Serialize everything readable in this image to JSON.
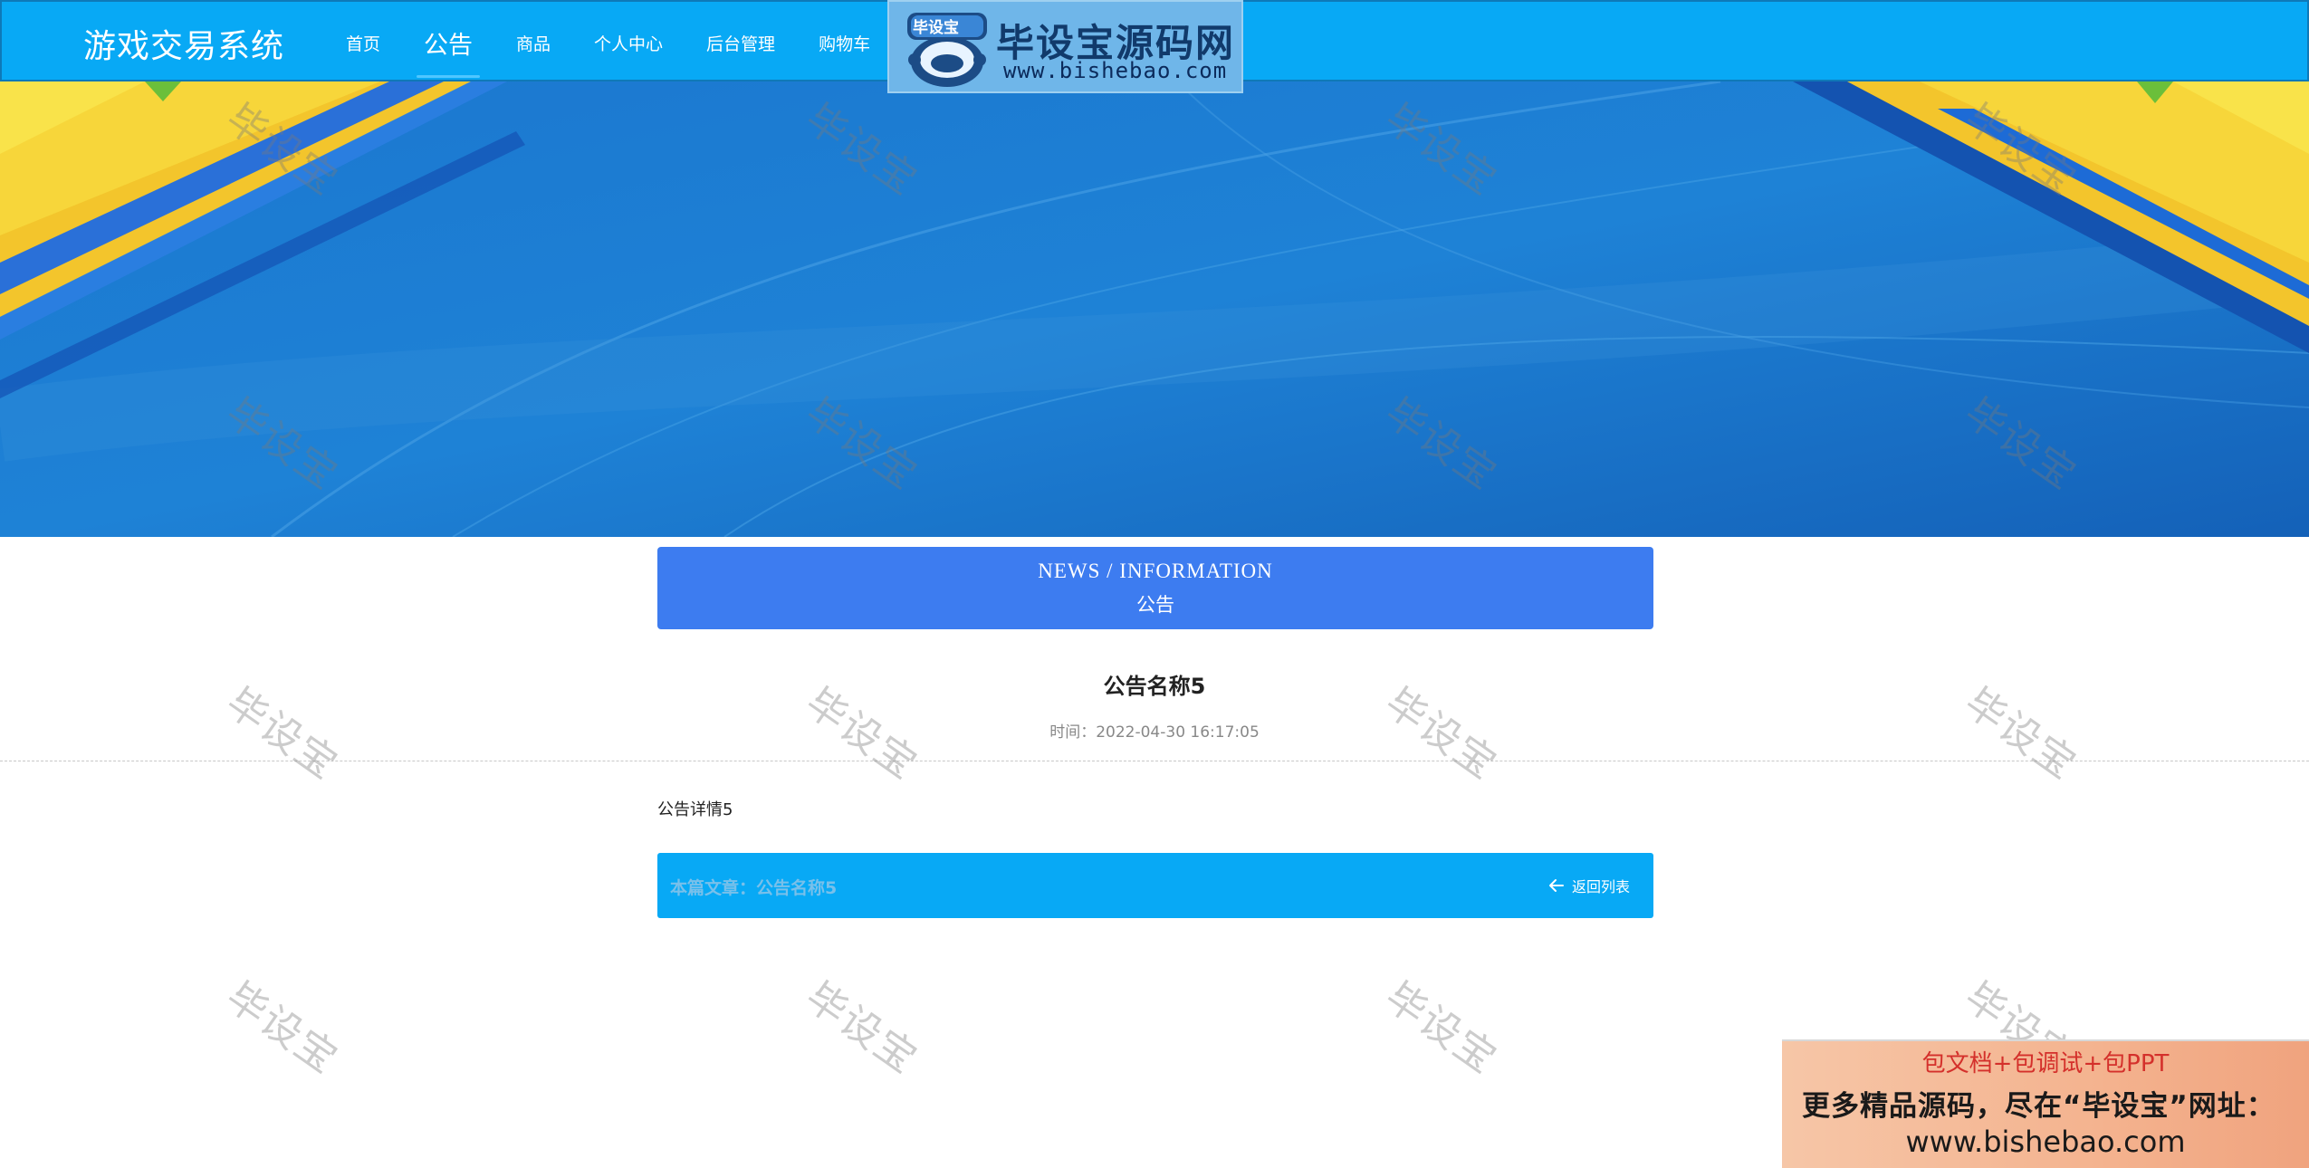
{
  "header": {
    "brand": "游戏交易系统",
    "nav": [
      {
        "label": "首页",
        "active": false
      },
      {
        "label": "公告",
        "active": true
      },
      {
        "label": "商品",
        "active": false
      },
      {
        "label": "个人中心",
        "active": false
      },
      {
        "label": "后台管理",
        "active": false
      },
      {
        "label": "购物车",
        "active": false
      }
    ],
    "bg_color": "#08a9f5"
  },
  "logo": {
    "badge_text": "毕设宝",
    "title": "毕设宝源码网",
    "url": "www.bishebao.com"
  },
  "banner": {
    "carousel_count": 3,
    "active_index": 0
  },
  "section": {
    "en_title": "NEWS / INFORMATION",
    "cn_title": "公告",
    "color": "#3d7cf0"
  },
  "article": {
    "title": "公告名称5",
    "time": "时间：2022-04-30 16:17:05",
    "content": "公告详情5",
    "current_label": "本篇文章：公告名称5",
    "back_label": "返回列表"
  },
  "watermark": {
    "text": "毕设宝"
  },
  "ad": {
    "line1": "包文档+包调试+包PPT",
    "line2": "更多精品源码，尽在“毕设宝”网址：",
    "line3": "www.bishebao.com"
  }
}
